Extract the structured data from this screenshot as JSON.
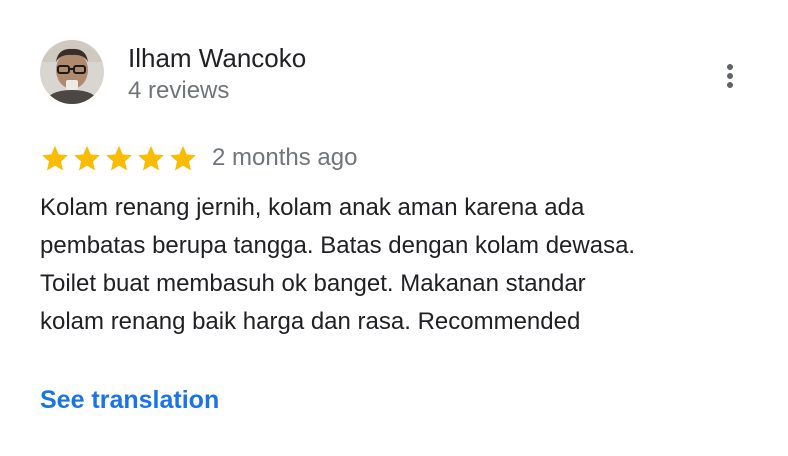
{
  "reviewer": {
    "name": "Ilham Wancoko",
    "review_count": "4 reviews"
  },
  "review": {
    "rating": 5,
    "rating_max": 5,
    "date": "2 months ago",
    "text": "Kolam renang jernih, kolam anak aman karena ada\npembatas berupa tangga. Batas dengan kolam dewasa.\nToilet buat membasuh ok banget. Makanan standar\nkolam renang baik harga dan rasa. Recommended"
  },
  "actions": {
    "translate_label": "See translation",
    "more_icon": "more-vert-icon"
  },
  "colors": {
    "star": "#fbbc04",
    "link": "#1a73e8",
    "secondary_text": "#70757a",
    "primary_text": "#202124"
  }
}
